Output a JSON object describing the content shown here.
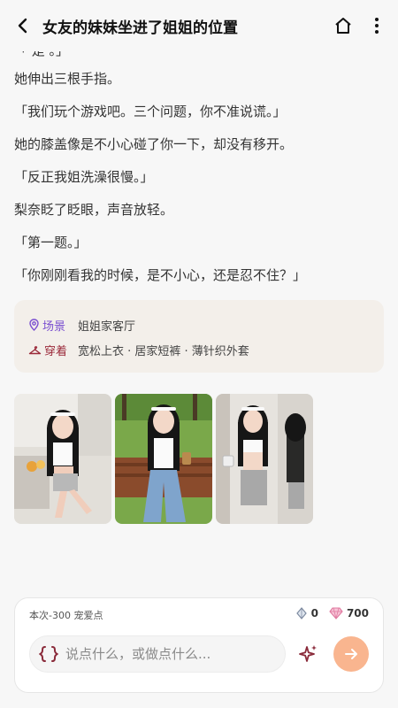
{
  "header": {
    "title": "女友的妹妹坐进了姐姐的位置",
    "back_icon": "chevron-left-icon",
    "home_icon": "home-icon",
    "more_icon": "more-vertical-icon"
  },
  "story": {
    "cut_line": "「 是 。」",
    "lines": [
      "她伸出三根手指。",
      "「我们玩个游戏吧。三个问题，你不准说谎。」",
      "她的膝盖像是不小心碰了你一下，却没有移开。",
      "「反正我姐洗澡很慢。」",
      "梨奈眨了眨眼，声音放轻。",
      "「第一题。」",
      "「你刚刚看我的时候，是不小心，还是忍不住？」"
    ]
  },
  "info": {
    "scene_label": "场景",
    "scene_value": "姐姐家客厅",
    "outfit_label": "穿着",
    "outfit_value": "宽松上衣 · 居家短裤 · 薄针织外套",
    "scene_color": "#7a4fd0",
    "outfit_color": "#9b2a3a"
  },
  "gallery": {
    "images": [
      "kitchen-photo",
      "park-bench-photo",
      "mirror-photo"
    ]
  },
  "bottom": {
    "cost_text": "本次-300 宠爱点",
    "diamond_count": "0",
    "gem_count": "700",
    "input_placeholder": "说点什么，或做点什么...",
    "send_color": "#f9b58f"
  }
}
